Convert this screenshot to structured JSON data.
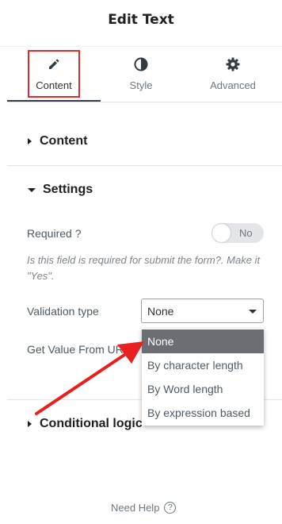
{
  "panel": {
    "title": "Edit Text"
  },
  "tabs": [
    {
      "label": "Content",
      "icon": "pencil-icon",
      "active": true
    },
    {
      "label": "Style",
      "icon": "contrast-icon",
      "active": false
    },
    {
      "label": "Advanced",
      "icon": "gear-icon",
      "active": false
    }
  ],
  "sections": {
    "content": {
      "label": "Content",
      "expanded": false
    },
    "settings": {
      "label": "Settings",
      "expanded": true
    },
    "conditional": {
      "label": "Conditional logic",
      "expanded": false
    }
  },
  "settings": {
    "required_label": "Required ?",
    "required_toggle": "No",
    "required_desc": "Is this field is required for submit the form?. Make it \"Yes\".",
    "validation_label": "Validation type",
    "validation_value": "None",
    "get_value_label": "Get Value From URL"
  },
  "validation_options": [
    "None",
    "By character length",
    "By Word length",
    "By expression based"
  ],
  "footer": {
    "need_help": "Need Help"
  },
  "colors": {
    "highlight": "#e02b2b",
    "arrow": "#e8201f",
    "selected_option": "#6b6e72"
  }
}
